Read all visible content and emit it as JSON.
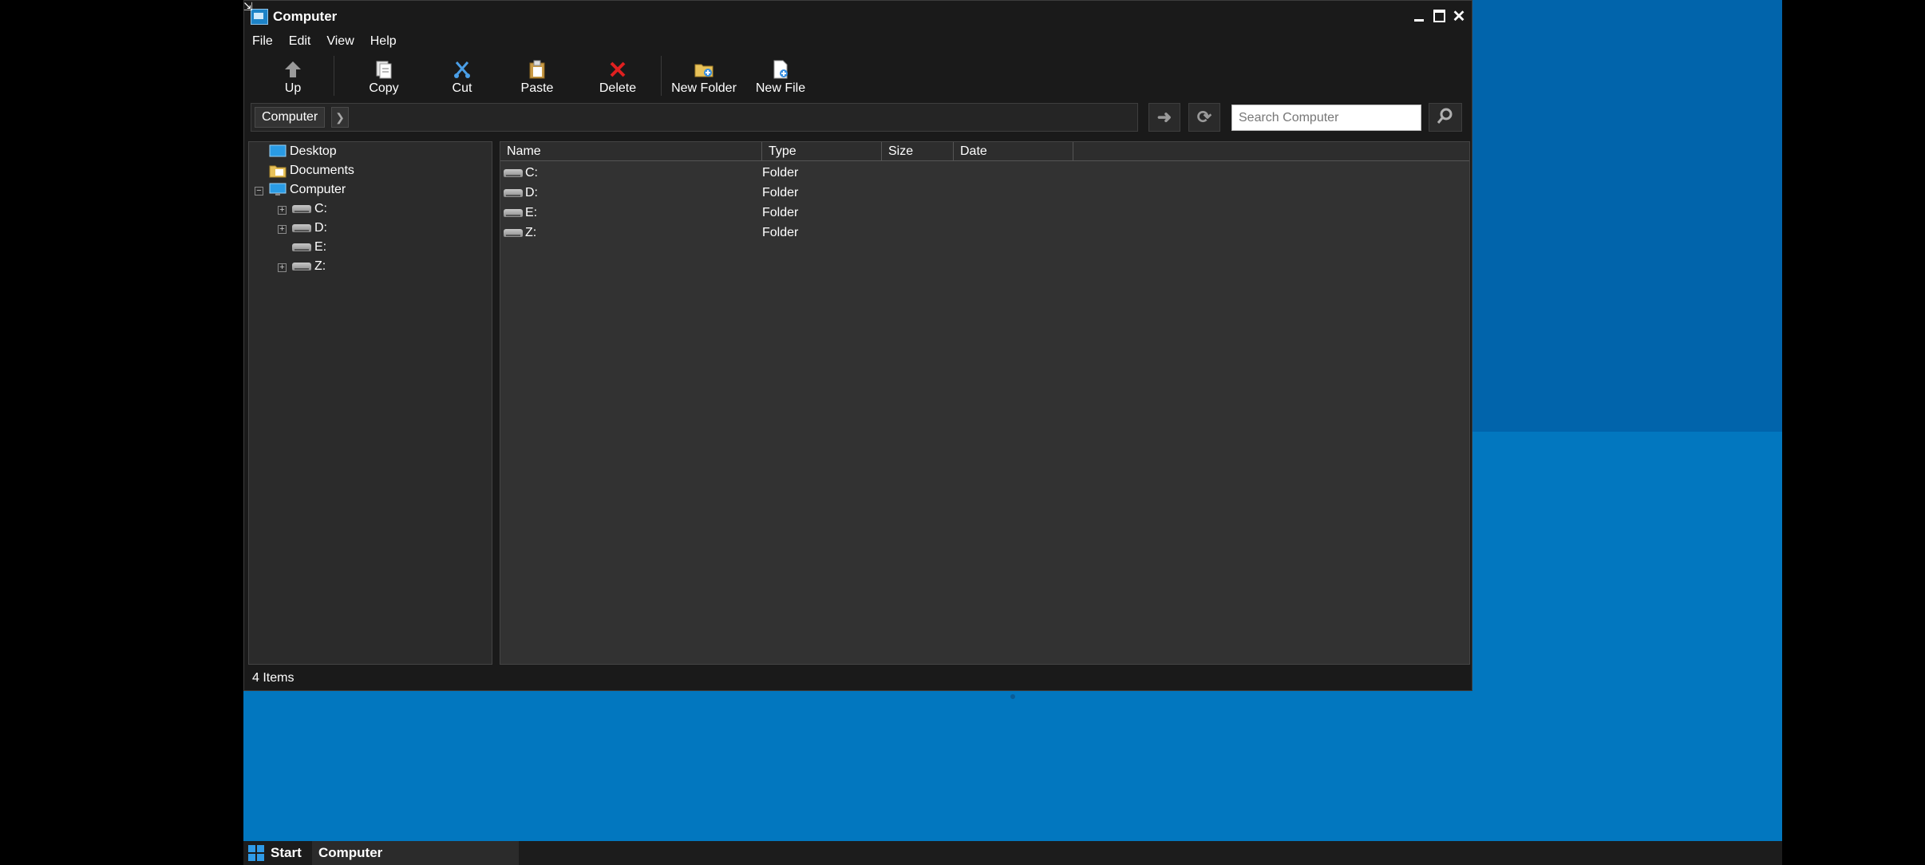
{
  "window": {
    "title": "Computer",
    "menus": [
      "File",
      "Edit",
      "View",
      "Help"
    ],
    "toolbar": {
      "up": "Up",
      "copy": "Copy",
      "cut": "Cut",
      "paste": "Paste",
      "delete": "Delete",
      "new_folder": "New Folder",
      "new_file": "New File"
    },
    "address": {
      "crumb": "Computer",
      "search_placeholder": "Search Computer"
    },
    "tree": {
      "desktop": "Desktop",
      "documents": "Documents",
      "computer": "Computer",
      "drives": [
        "C:",
        "D:",
        "E:",
        "Z:"
      ]
    },
    "list": {
      "columns": {
        "name": "Name",
        "type": "Type",
        "size": "Size",
        "date": "Date"
      },
      "rows": [
        {
          "name": "C:",
          "type": "Folder"
        },
        {
          "name": "D:",
          "type": "Folder"
        },
        {
          "name": "E:",
          "type": "Folder"
        },
        {
          "name": "Z:",
          "type": "Folder"
        }
      ]
    },
    "status": "4 Items"
  },
  "taskbar": {
    "start": "Start",
    "task": "Computer"
  },
  "colors": {
    "desktop": "#0277bf",
    "window_bg": "#1a1a1a",
    "accent": "#2f9be8",
    "delete_red": "#e02020"
  }
}
